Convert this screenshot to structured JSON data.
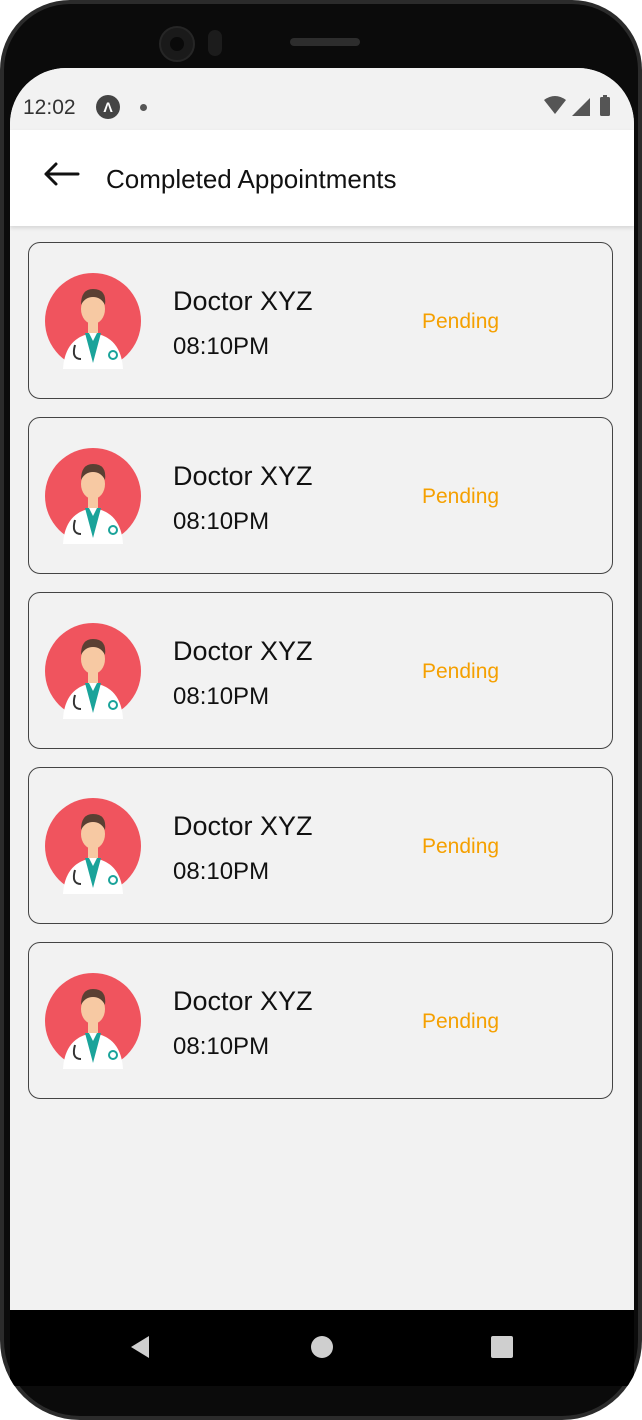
{
  "status_bar": {
    "time": "12:02",
    "app_icon": "Λ"
  },
  "header": {
    "title": "Completed Appointments",
    "back_icon": "arrow-left-icon"
  },
  "appointments": [
    {
      "doctor": "Doctor XYZ",
      "time": "08:10PM",
      "status": "Pending"
    },
    {
      "doctor": "Doctor XYZ",
      "time": "08:10PM",
      "status": "Pending"
    },
    {
      "doctor": "Doctor XYZ",
      "time": "08:10PM",
      "status": "Pending"
    },
    {
      "doctor": "Doctor XYZ",
      "time": "08:10PM",
      "status": "Pending"
    },
    {
      "doctor": "Doctor XYZ",
      "time": "08:10PM",
      "status": "Pending"
    }
  ],
  "colors": {
    "status_pending": "#f5a000",
    "avatar_background": "#f0545e",
    "screen_background": "#f2f2f2"
  },
  "nav_bar": {
    "buttons": [
      "back-triangle-icon",
      "home-circle-icon",
      "recents-square-icon"
    ]
  }
}
